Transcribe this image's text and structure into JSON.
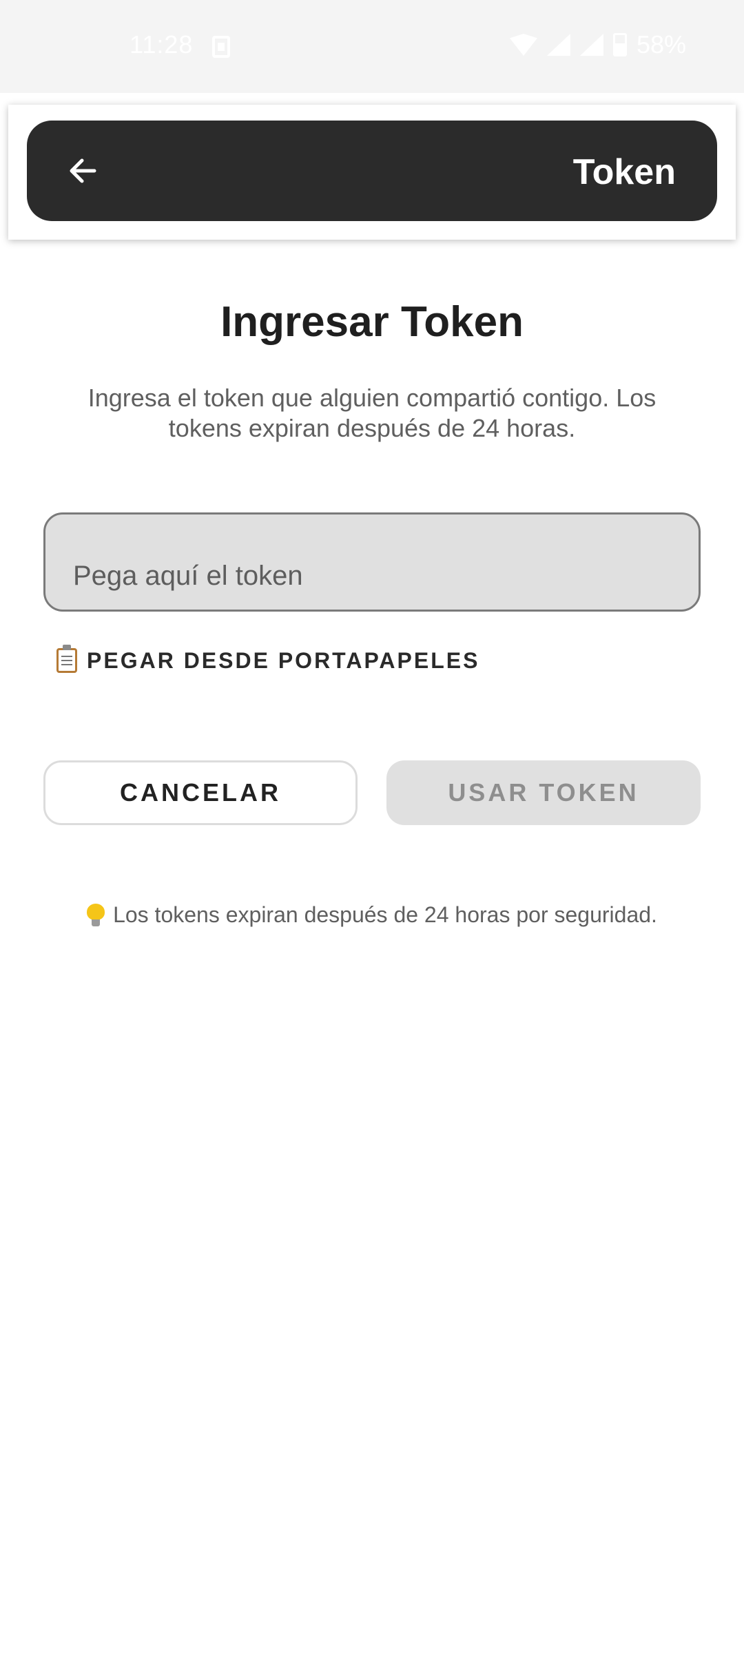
{
  "status_bar": {
    "time": "11:28",
    "battery": "58%",
    "battery_level": 0.58
  },
  "app_bar": {
    "title": "Token"
  },
  "main": {
    "title": "Ingresar Token",
    "description": "Ingresa el token que alguien compartió contigo. Los tokens expiran después de 24 horas.",
    "token_input": {
      "value": "",
      "placeholder": "Pega aquí el token"
    },
    "paste_label": "PEGAR DESDE PORTAPAPELES",
    "cancel_label": "CANCELAR",
    "use_token_label": "USAR TOKEN",
    "note": "Los tokens expiran después de 24 horas por seguridad."
  },
  "icons": {
    "back": "arrow-left-icon",
    "paste": "clipboard-icon",
    "note": "lightbulb-icon"
  },
  "colors": {
    "app_bar": "#2b2b2b",
    "input_bg": "#e0e0e0",
    "disabled_button_bg": "#e0e0e0",
    "disabled_button_text": "#8e8e8e"
  }
}
